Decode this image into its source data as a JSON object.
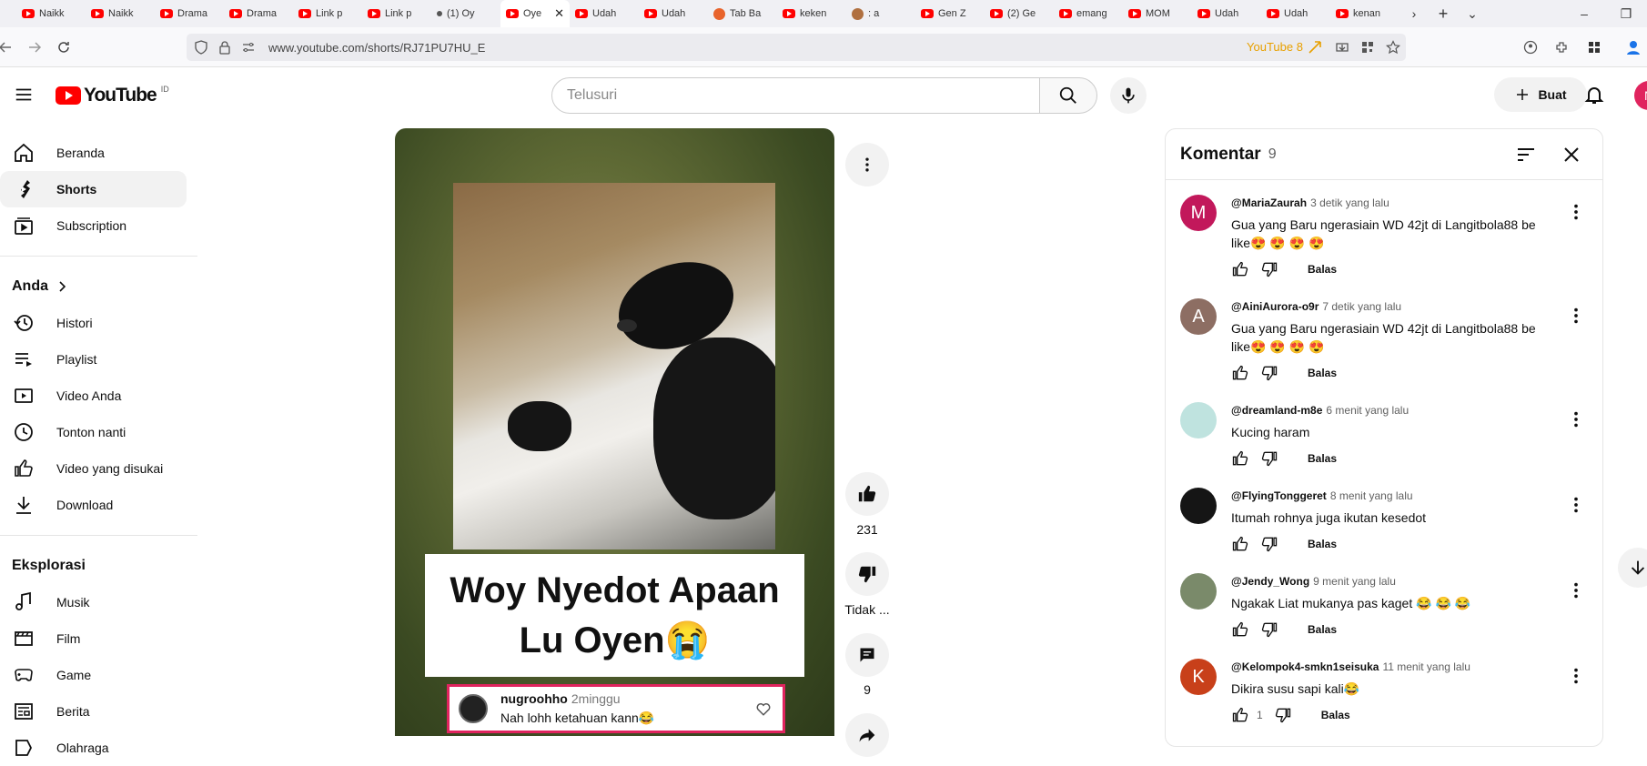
{
  "browser": {
    "tabs": [
      {
        "label": "Naikk",
        "icon": "youtube-icon"
      },
      {
        "label": "Naikk",
        "icon": "youtube-icon"
      },
      {
        "label": "Drama",
        "icon": "youtube-icon"
      },
      {
        "label": "Drama",
        "icon": "youtube-icon"
      },
      {
        "label": "Link p",
        "icon": "youtube-icon"
      },
      {
        "label": "Link p",
        "icon": "youtube-icon"
      },
      {
        "label": "(1) Oy",
        "icon": "dot-icon"
      },
      {
        "label": "Oye",
        "icon": "youtube-icon",
        "active": true
      },
      {
        "label": "Udah",
        "icon": "youtube-icon"
      },
      {
        "label": "Udah",
        "icon": "youtube-icon"
      },
      {
        "label": "Tab Ba",
        "icon": "firefox-icon"
      },
      {
        "label": "keken",
        "icon": "youtube-icon"
      },
      {
        "label": ": a",
        "icon": "monkey-icon"
      },
      {
        "label": "Gen Z",
        "icon": "youtube-icon"
      },
      {
        "label": "(2) Ge",
        "icon": "youtube-icon"
      },
      {
        "label": "emang",
        "icon": "youtube-icon"
      },
      {
        "label": "MOM",
        "icon": "youtube-icon"
      },
      {
        "label": "Udah",
        "icon": "youtube-icon"
      },
      {
        "label": "Udah",
        "icon": "youtube-icon"
      },
      {
        "label": "kenan",
        "icon": "youtube-icon"
      }
    ],
    "url": "www.youtube.com/shorts/RJ71PU7HU_E",
    "badge": "YouTube 8"
  },
  "header": {
    "logo": "YouTube",
    "country": "ID",
    "search_placeholder": "Telusuri",
    "create_label": "Buat",
    "avatar_letter": "N"
  },
  "sidebar": {
    "main": [
      {
        "label": "Beranda",
        "icon": "home-icon"
      },
      {
        "label": "Shorts",
        "icon": "shorts-icon"
      },
      {
        "label": "Subscription",
        "icon": "subscriptions-icon"
      }
    ],
    "you_heading": "Anda",
    "you": [
      {
        "label": "Histori",
        "icon": "history-icon"
      },
      {
        "label": "Playlist",
        "icon": "playlist-icon"
      },
      {
        "label": "Video Anda",
        "icon": "your-videos-icon"
      },
      {
        "label": "Tonton nanti",
        "icon": "watch-later-icon"
      },
      {
        "label": "Video yang disukai",
        "icon": "liked-icon"
      },
      {
        "label": "Download",
        "icon": "download-icon"
      }
    ],
    "explore_heading": "Eksplorasi",
    "explore": [
      {
        "label": "Musik",
        "icon": "music-icon"
      },
      {
        "label": "Film",
        "icon": "film-icon"
      },
      {
        "label": "Game",
        "icon": "gaming-icon"
      },
      {
        "label": "Berita",
        "icon": "news-icon"
      },
      {
        "label": "Olahraga",
        "icon": "sports-icon"
      }
    ]
  },
  "short": {
    "caption": "Woy Nyedot Apaan Lu Oyen😭",
    "overlay_comment": {
      "user": "nugroohho",
      "ago": "2minggu",
      "text": "Nah lohh ketahuan kann😂"
    },
    "likes": "231",
    "dislike_label": "Tidak ...",
    "comments_count": "9"
  },
  "comments_panel": {
    "title": "Komentar",
    "count": "9",
    "reply_label": "Balas",
    "items": [
      {
        "user": "@MariaZaurah",
        "ago": "3 detik yang lalu",
        "text": "Gua yang Baru ngerasiain WD 42jt di Langitbola88 be like😍 😍 😍 😍",
        "avatar": "M",
        "avatar_color": "#c2185b",
        "likes": ""
      },
      {
        "user": "@AiniAurora-o9r",
        "ago": "7 detik yang lalu",
        "text": "Gua yang Baru ngerasiain WD 42jt di Langitbola88 be like😍 😍 😍 😍",
        "avatar": "A",
        "avatar_color": "#8d6e63",
        "likes": ""
      },
      {
        "user": "@dreamland-m8e",
        "ago": "6 menit yang lalu",
        "text": "Kucing haram",
        "avatar": "",
        "avatar_color": "#bfe3df",
        "likes": ""
      },
      {
        "user": "@FlyingTonggeret",
        "ago": "8 menit yang lalu",
        "text": "Itumah rohnya juga ikutan kesedot",
        "avatar": "",
        "avatar_color": "#151515",
        "likes": ""
      },
      {
        "user": "@Jendy_Wong",
        "ago": "9 menit yang lalu",
        "text": "Ngakak Liat mukanya pas kaget 😂 😂 😂",
        "avatar": "",
        "avatar_color": "#7a8a6a",
        "likes": ""
      },
      {
        "user": "@Kelompok4-smkn1seisuka",
        "ago": "11 menit yang lalu",
        "text": "Dikira susu sapi kali😂",
        "avatar": "K",
        "avatar_color": "#c8401a",
        "likes": "1"
      }
    ]
  }
}
